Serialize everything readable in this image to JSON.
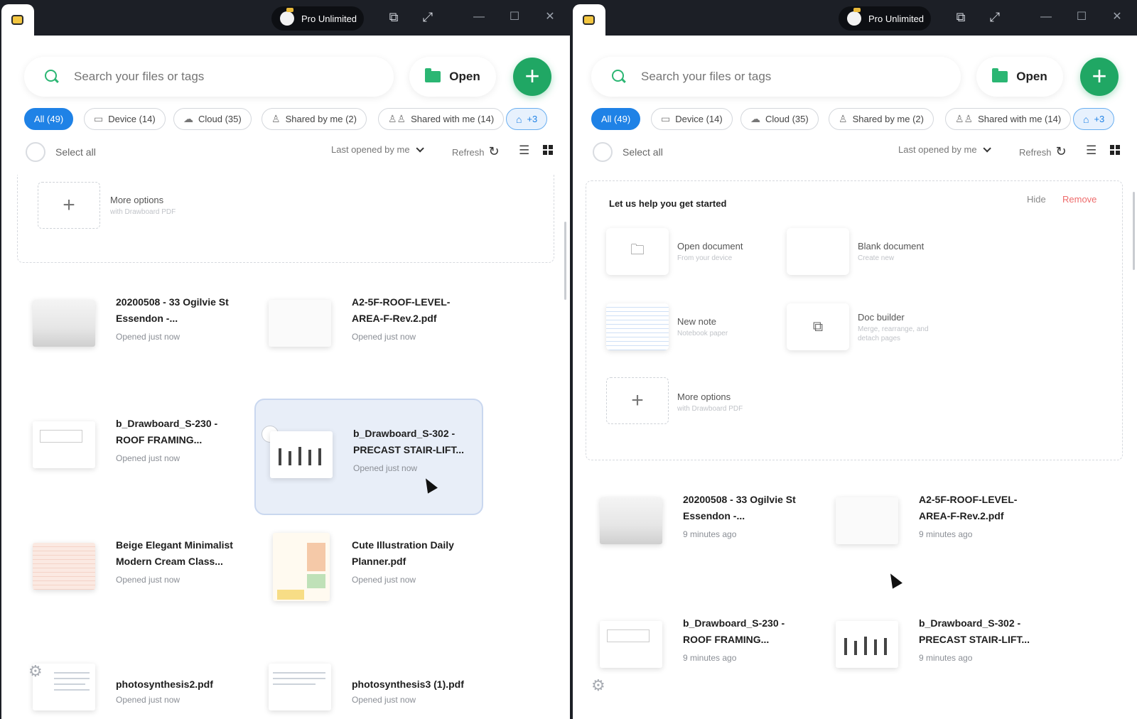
{
  "app": {
    "pro_label": "Pro Unlimited",
    "search_placeholder": "Search your files or tags",
    "open_label": "Open",
    "add_label": "+"
  },
  "filters": {
    "all": "All (49)",
    "device": "Device (14)",
    "cloud": "Cloud (35)",
    "shared_by_me": "Shared by me (2)",
    "shared_with_me": "Shared with me (14)",
    "tags": "+3"
  },
  "toolbar": {
    "select_all": "Select all",
    "sort": "Last opened by me",
    "refresh": "Refresh"
  },
  "left": {
    "more_options": {
      "title": "More options",
      "sub": "with Drawboard PDF"
    },
    "files": [
      {
        "name": "20200508 - 33 Ogilvie St Essendon -...",
        "meta": "Opened just now"
      },
      {
        "name": "A2-5F-ROOF-LEVEL-AREA-F-Rev.2.pdf",
        "meta": "Opened just now"
      },
      {
        "name": "b_Drawboard_S-230 - ROOF FRAMING...",
        "meta": "Opened just now"
      },
      {
        "name": "b_Drawboard_S-302 - PRECAST STAIR-LIFT...",
        "meta": "Opened just now"
      },
      {
        "name": "Beige Elegant Minimalist Modern Cream Class...",
        "meta": "Opened just now"
      },
      {
        "name": "Cute Illustration Daily Planner.pdf",
        "meta": "Opened just now"
      },
      {
        "name": "photosynthesis2.pdf",
        "meta": "Opened just now"
      },
      {
        "name": "photosynthesis3 (1).pdf",
        "meta": "Opened just now"
      }
    ]
  },
  "right": {
    "getting_started": {
      "title": "Let us help you get started",
      "hide": "Hide",
      "remove": "Remove",
      "options": [
        {
          "title": "Open document",
          "sub": "From your device"
        },
        {
          "title": "Blank document",
          "sub": "Create new"
        },
        {
          "title": "New note",
          "sub": "Notebook paper"
        },
        {
          "title": "Doc builder",
          "sub": "Merge, rearrange, and detach pages"
        },
        {
          "title": "More options",
          "sub": "with Drawboard PDF"
        }
      ]
    },
    "files": [
      {
        "name": "20200508 - 33 Ogilvie St Essendon -...",
        "meta": "9 minutes ago"
      },
      {
        "name": "A2-5F-ROOF-LEVEL-AREA-F-Rev.2.pdf",
        "meta": "9 minutes ago"
      },
      {
        "name": "b_Drawboard_S-230 - ROOF FRAMING...",
        "meta": "9 minutes ago"
      },
      {
        "name": "b_Drawboard_S-302 - PRECAST STAIR-LIFT...",
        "meta": "9 minutes ago"
      }
    ]
  },
  "colors": {
    "accent_green": "#20a764",
    "accent_blue": "#1f82e6",
    "remove_red": "#ee6b6b"
  }
}
